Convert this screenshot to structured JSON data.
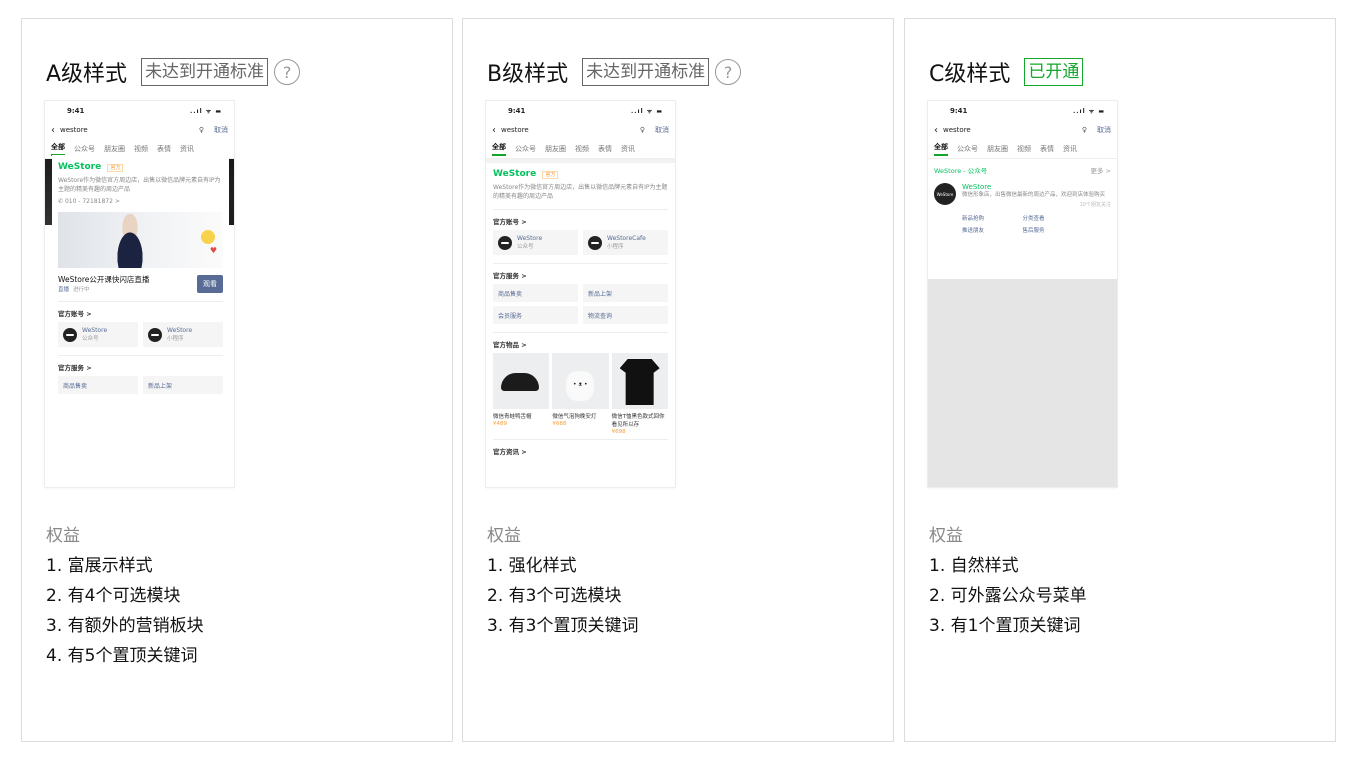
{
  "cards": [
    {
      "title": "A级样式",
      "status": "未达到开通标准",
      "help_icon": "?",
      "phone": {
        "time": "9:41",
        "status_icons": "..ıl ᯤ ▬",
        "query": "westore",
        "cancel": "取消",
        "tabs": [
          "全部",
          "公众号",
          "朋友圈",
          "视频",
          "表情",
          "资讯"
        ],
        "brand": "WeStore",
        "tag": "官方",
        "desc": "WeStore作为微信官方周边店，出售以微信品牌元素自有IP为主题的精美有趣的周边产品",
        "phone_line": "010 - 72181872 >",
        "live_title": "WeStore公开课快闪店直播",
        "live_label": "直播",
        "live_state": "进行中",
        "watch": "观看",
        "sec_accounts": "官方账号 >",
        "acc1_name": "WeStore",
        "acc1_sub": "公众号",
        "acc2_name": "WeStore",
        "acc2_sub": "小程序",
        "sec_services": "官方服务 >",
        "svc1": "商品售卖",
        "svc2": "新品上架"
      },
      "benefit_title": "权益",
      "benefits": [
        "1. 富展示样式",
        "2. 有4个可选模块",
        "3. 有额外的营销板块",
        "4. 有5个置顶关键词"
      ]
    },
    {
      "title": "B级样式",
      "status": "未达到开通标准",
      "help_icon": "?",
      "phone": {
        "time": "9:41",
        "status_icons": "..ıl ᯤ ▬",
        "query": "westore",
        "cancel": "取消",
        "tabs": [
          "全部",
          "公众号",
          "朋友圈",
          "视频",
          "表情",
          "资讯"
        ],
        "brand": "WeStore",
        "tag": "官方",
        "desc": "WeStore作为微信官方周边店，出售以微信品牌元素自有IP为主题的精美有趣的周边产品",
        "sec_accounts": "官方账号 >",
        "acc1_name": "WeStore",
        "acc1_sub": "公众号",
        "acc2_name": "WeStoreCafe",
        "acc2_sub": "小程序",
        "sec_services": "官方服务 >",
        "svc1": "商品售卖",
        "svc2": "新品上架",
        "svc3": "会员服务",
        "svc4": "物流查询",
        "sec_products": "官方物品 >",
        "products": [
          {
            "name": "微信青蛙鸭舌帽",
            "price": "¥489"
          },
          {
            "name": "微信气泡狗晚安灯",
            "price": "¥688"
          },
          {
            "name": "微信T恤黑色款式回你看见所以存",
            "price": "¥698"
          }
        ],
        "sec_more": "官方资讯 >"
      },
      "benefit_title": "权益",
      "benefits": [
        "1. 强化样式",
        "2. 有3个可选模块",
        "3. 有3个置顶关键词"
      ]
    },
    {
      "title": "C级样式",
      "status": "已开通",
      "phone": {
        "time": "9:41",
        "status_icons": "..ıl ᯤ ▬",
        "query": "westore",
        "cancel": "取消",
        "tabs": [
          "全部",
          "公众号",
          "朋友圈",
          "视频",
          "表情",
          "资讯"
        ],
        "head_left": "WeStore - 公众号",
        "head_right": "更多 >",
        "logo_text": "WeStore",
        "name": "WeStore",
        "desc": "微信形象店，出售微信最新的周边产品，欢迎到店体验购买",
        "followers": "10个朋友关注",
        "menu": [
          "新品抢购",
          "分类查看",
          "推送朋友",
          "售后服务"
        ]
      },
      "benefit_title": "权益",
      "benefits": [
        "1. 自然样式",
        "2. 可外露公众号菜单",
        "3. 有1个置顶关键词"
      ]
    }
  ]
}
